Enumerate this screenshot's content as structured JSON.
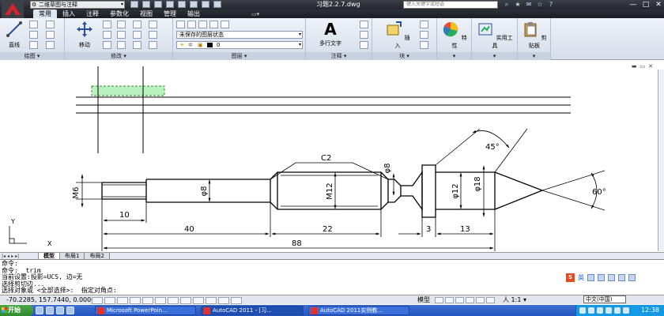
{
  "titlebar": {
    "workspace": "二维草图与注释",
    "document_title": "习题2.2.7.dwg",
    "search_placeholder": "键入关键字或短语",
    "window_buttons": [
      "—",
      "□",
      "✕"
    ]
  },
  "ribbon": {
    "tabs": [
      "常用",
      "插入",
      "注释",
      "参数化",
      "视图",
      "管理",
      "输出"
    ],
    "active_tab": "常用",
    "panels": {
      "draw": {
        "title": "绘图",
        "line_label": "直线"
      },
      "modify": {
        "title": "修改",
        "move_label": "移动"
      },
      "layers": {
        "title": "图层",
        "layer_state": "未保存的图层状态",
        "current_layer": "0"
      },
      "annotation": {
        "title": "注释",
        "mtext_label": "多行文字"
      },
      "block": {
        "title": "块",
        "insert_label": "插入"
      },
      "properties": {
        "title": "",
        "label": "特性"
      },
      "utilities": {
        "title": "",
        "label": "实用工具"
      },
      "clipboard": {
        "title": "",
        "label": "剪贴板"
      }
    }
  },
  "drawing": {
    "dimensions": {
      "m6": "M6",
      "phi8_left": "φ8",
      "m12": "M12",
      "phi8_top": "φ8",
      "phi12": "φ12",
      "phi18": "φ18",
      "c2": "C2",
      "angle45": "45°",
      "angle60": "60°",
      "d10": "10",
      "d40": "40",
      "d22": "22",
      "d3": "3",
      "d13": "13",
      "d88": "88"
    },
    "ucs": {
      "x": "X",
      "y": "Y"
    }
  },
  "layout_tabs": [
    "模型",
    "布局1",
    "布局2"
  ],
  "command": {
    "lines": [
      "命令:",
      "命令:  trim",
      "当前设置:投影=UCS, 边=无",
      "选择剪切边...",
      "选择对象或 <全部选择>:  指定对角点:"
    ],
    "ime_label": "英"
  },
  "statusbar": {
    "coordinates": "-70.2285, 157.7440, 0.0000",
    "space": "模型",
    "annotation_scale": "人 1:1 ▾",
    "language": "中文(中国)"
  },
  "taskbar": {
    "start_label": "开始",
    "tasks": [
      "Microsoft PowerPoin...",
      "AutoCAD 2011 - [习...",
      "AutoCAD 2011实例教..."
    ],
    "clock": "12:38"
  },
  "colors": {
    "accent": "#2555c2",
    "selection": "#b9f2c0",
    "ribbon": "#dfe6f1"
  }
}
